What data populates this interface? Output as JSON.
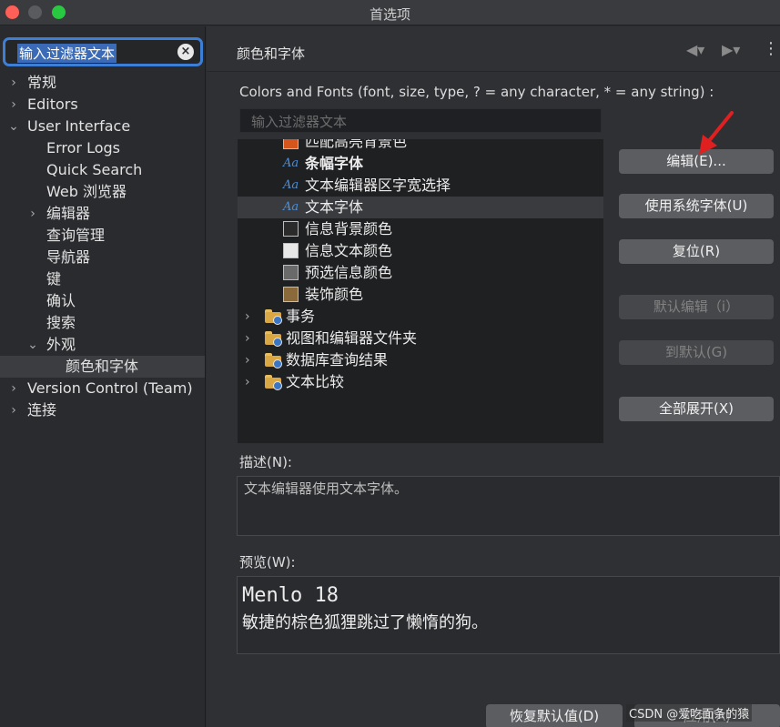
{
  "window": {
    "title": "首选项"
  },
  "left": {
    "filter_value": "输入过滤器文本",
    "tree": [
      {
        "label": "常规",
        "level": 0,
        "arrow": "›"
      },
      {
        "label": "Editors",
        "level": 0,
        "arrow": "›"
      },
      {
        "label": "User Interface",
        "level": 0,
        "arrow": "⌄"
      },
      {
        "label": "Error Logs",
        "level": 1,
        "arrow": ""
      },
      {
        "label": "Quick Search",
        "level": 1,
        "arrow": ""
      },
      {
        "label": "Web 浏览器",
        "level": 1,
        "arrow": ""
      },
      {
        "label": "编辑器",
        "level": 1,
        "arrow": "›"
      },
      {
        "label": "查询管理",
        "level": 1,
        "arrow": ""
      },
      {
        "label": "导航器",
        "level": 1,
        "arrow": ""
      },
      {
        "label": "键",
        "level": 1,
        "arrow": ""
      },
      {
        "label": "确认",
        "level": 1,
        "arrow": ""
      },
      {
        "label": "搜索",
        "level": 1,
        "arrow": ""
      },
      {
        "label": "外观",
        "level": 1,
        "arrow": "⌄"
      },
      {
        "label": "颜色和字体",
        "level": 2,
        "arrow": "",
        "selected": true
      },
      {
        "label": "Version Control (Team)",
        "level": 0,
        "arrow": "›"
      },
      {
        "label": "连接",
        "level": 0,
        "arrow": "›"
      }
    ]
  },
  "right": {
    "title": "颜色和字体",
    "colors_fonts_label": "Colors and Fonts (font, size, type, ? = any character, * = any string) :",
    "filter_placeholder": "输入过滤器文本",
    "tree": [
      {
        "kind": "swatch",
        "label": "匹配高亮背景色",
        "color": "#d4561d"
      },
      {
        "kind": "font",
        "label": "条幅字体",
        "bold": true
      },
      {
        "kind": "font",
        "label": "文本编辑器区字宽选择"
      },
      {
        "kind": "font",
        "label": "文本字体",
        "selected": true
      },
      {
        "kind": "swatch",
        "label": "信息背景颜色",
        "color": "#2b2b2b"
      },
      {
        "kind": "swatch",
        "label": "信息文本颜色",
        "color": "#e8e8e8"
      },
      {
        "kind": "swatch",
        "label": "预选信息颜色",
        "color": "#6a6a6a"
      },
      {
        "kind": "swatch",
        "label": "装饰颜色",
        "color": "#8a6a3a"
      },
      {
        "kind": "folder",
        "label": "事务"
      },
      {
        "kind": "folder",
        "label": "视图和编辑器文件夹"
      },
      {
        "kind": "folder",
        "label": "数据库查询结果"
      },
      {
        "kind": "folder",
        "label": "文本比较"
      }
    ],
    "font_icon_glyph": "Aa",
    "buttons": {
      "edit": "编辑(E)...",
      "use_system_font": "使用系统字体(U)",
      "reset": "复位(R)",
      "edit_default": "默认编辑（i）",
      "go_default": "到默认(G)",
      "expand_all": "全部展开(X)"
    },
    "description_label": "描述(N):",
    "description_text": "文本编辑器使用文本字体。",
    "preview_label": "预览(W):",
    "preview_font": "Menlo 18",
    "preview_sample": "敏捷的棕色狐狸跳过了懒惰的狗。",
    "restore_defaults": "恢复默认值(D)",
    "apply": "应用(A)"
  },
  "watermark": "CSDN @爱吃面条的猿",
  "colors": {
    "accent": "#3d7fd6",
    "annotation_arrow": "#e02020"
  }
}
